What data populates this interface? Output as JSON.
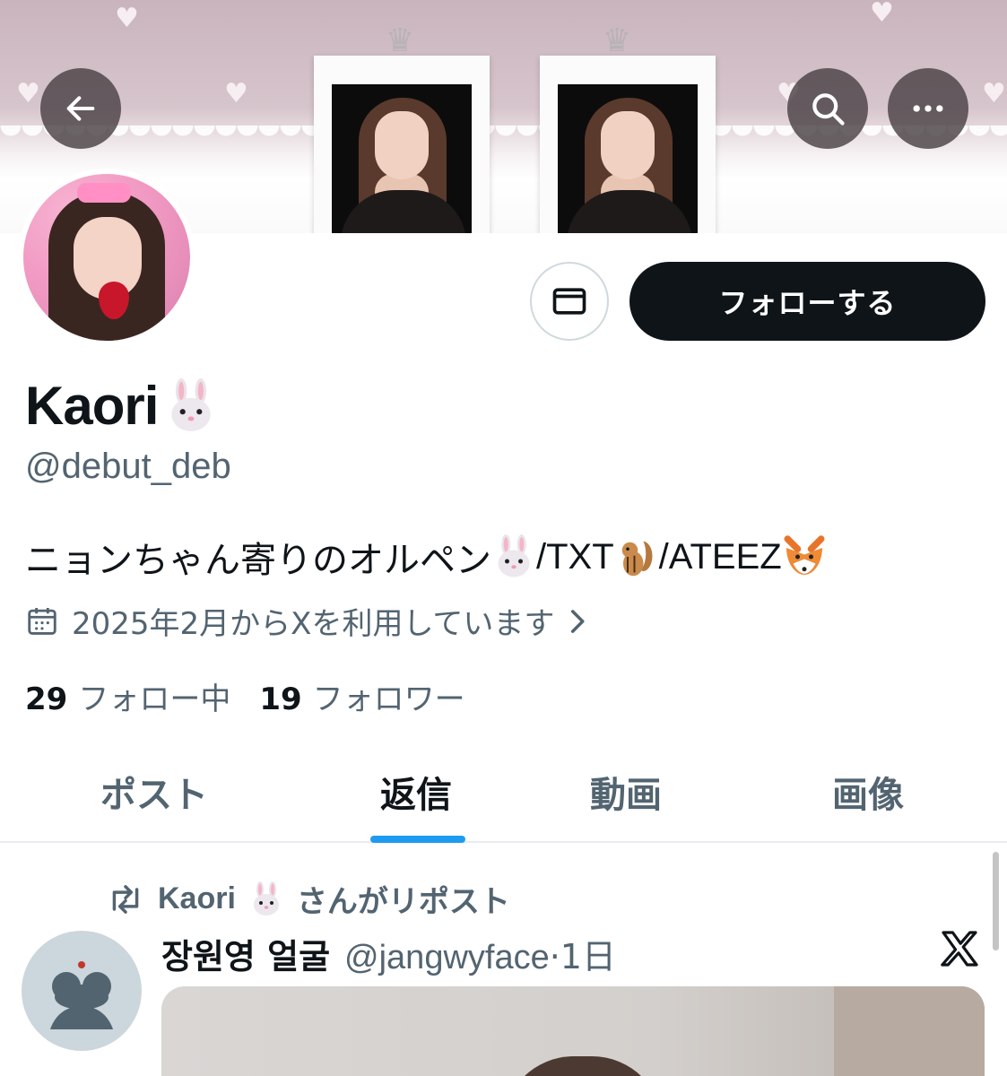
{
  "header": {
    "back_icon": "arrow-left-icon",
    "search_icon": "search-icon",
    "more_icon": "more-horizontal-icon"
  },
  "profile": {
    "display_name": "Kaori",
    "name_emoji": "rabbit-face-emoji",
    "handle": "@debut_deb",
    "bio": {
      "text1": "ニョンちゃん寄りのオルペン",
      "text2": "/TXT",
      "text3": "/ATEEZ",
      "emojis": [
        "rabbit-face-emoji",
        "chipmunk-emoji",
        "fox-face-emoji"
      ]
    },
    "joined": "2025年2月からXを利用しています",
    "following_count": "29",
    "following_label": "フォロー中",
    "followers_count": "19",
    "followers_label": "フォロワー"
  },
  "actions": {
    "follow_label": "フォローする",
    "dm_icon": "envelope-icon"
  },
  "tabs": [
    {
      "label": "ポスト"
    },
    {
      "label": "返信"
    },
    {
      "label": "動画"
    },
    {
      "label": "画像"
    }
  ],
  "active_tab": "返信",
  "feed": {
    "repost_label_name": "Kaori",
    "repost_label_suffix": "さんがリポスト",
    "post": {
      "author": "장원영 얼굴",
      "handle": "@jangwyface",
      "time": "·1日"
    }
  },
  "colors": {
    "accent": "#1d9bf0",
    "text_primary": "#0f1419",
    "text_secondary": "#536471",
    "button_dark": "#0f1419"
  }
}
